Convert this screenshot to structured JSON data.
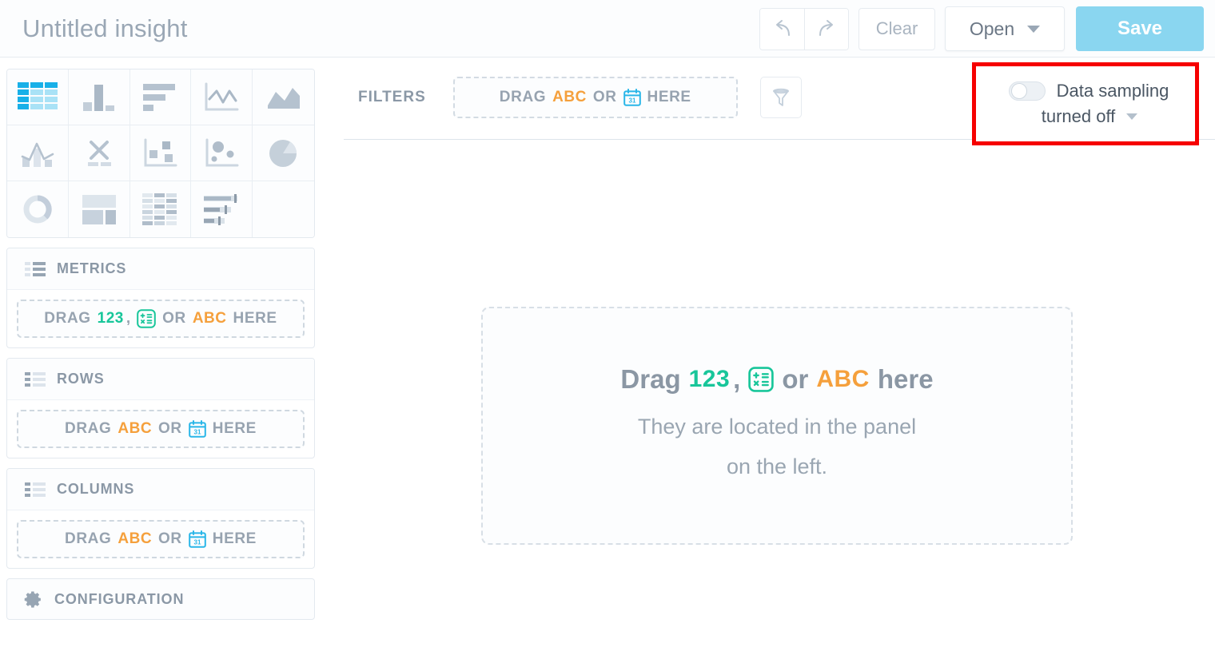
{
  "header": {
    "title": "Untitled insight",
    "undo_label": "undo-arrow",
    "redo_label": "redo-arrow",
    "clear_label": "Clear",
    "open_label": "Open",
    "save_label": "Save"
  },
  "chart_types": [
    {
      "name": "table",
      "label": "Table"
    },
    {
      "name": "column-chart",
      "label": "Column chart"
    },
    {
      "name": "bar-chart",
      "label": "Bar chart"
    },
    {
      "name": "line-chart",
      "label": "Line chart"
    },
    {
      "name": "area-chart",
      "label": "Area chart"
    },
    {
      "name": "combo-chart",
      "label": "Combo chart"
    },
    {
      "name": "scatter-x-chart",
      "label": "Scatter chart"
    },
    {
      "name": "treemap-chart",
      "label": "Treemap"
    },
    {
      "name": "bubble-chart",
      "label": "Bubble chart"
    },
    {
      "name": "pie-chart",
      "label": "Pie chart"
    },
    {
      "name": "donut-chart",
      "label": "Donut chart"
    },
    {
      "name": "dashboard-layout",
      "label": "Layout"
    },
    {
      "name": "heatmap-chart",
      "label": "Heatmap"
    },
    {
      "name": "bullet-chart",
      "label": "Bullet chart"
    },
    {
      "name": "empty-slot",
      "label": ""
    }
  ],
  "sections": [
    {
      "key": "metrics",
      "title": "METRICS",
      "dropzone": {
        "drag": "DRAG",
        "token1": "123",
        "comma": ",",
        "calc_icon": "calculator-icon",
        "or": "OR",
        "token2": "ABC",
        "here": "HERE"
      }
    },
    {
      "key": "rows",
      "title": "ROWS",
      "dropzone": {
        "drag": "DRAG",
        "token1": "ABC",
        "or": "OR",
        "date_icon": "calendar-icon",
        "here": "HERE"
      }
    },
    {
      "key": "columns",
      "title": "COLUMNS",
      "dropzone": {
        "drag": "DRAG",
        "token1": "ABC",
        "or": "OR",
        "date_icon": "calendar-icon",
        "here": "HERE"
      }
    }
  ],
  "configuration": {
    "title": "CONFIGURATION"
  },
  "filters": {
    "label": "FILTERS",
    "dropzone": {
      "drag": "DRAG",
      "token1": "ABC",
      "or": "OR",
      "date_icon": "calendar-icon",
      "here": "HERE"
    },
    "funnel_icon": "funnel-icon"
  },
  "canvas": {
    "drag": "Drag",
    "token1": "123",
    "comma": ",",
    "calc_icon": "calculator-icon",
    "or": "or",
    "token2": "ABC",
    "here": "here",
    "subtitle_line1": "They are located in the panel",
    "subtitle_line2": "on the left."
  },
  "sampling": {
    "toggle_state": "off",
    "line1": "Data sampling",
    "line2": "turned off",
    "chevron_icon": "chevron-down-icon"
  },
  "colors": {
    "accent_blue": "#18b0e8",
    "save_blue": "#8ad6f0",
    "metric_green": "#18c69a",
    "attribute_orange": "#f5a03c",
    "text_gray": "#8b98a6",
    "highlight_red": "#f60000"
  }
}
